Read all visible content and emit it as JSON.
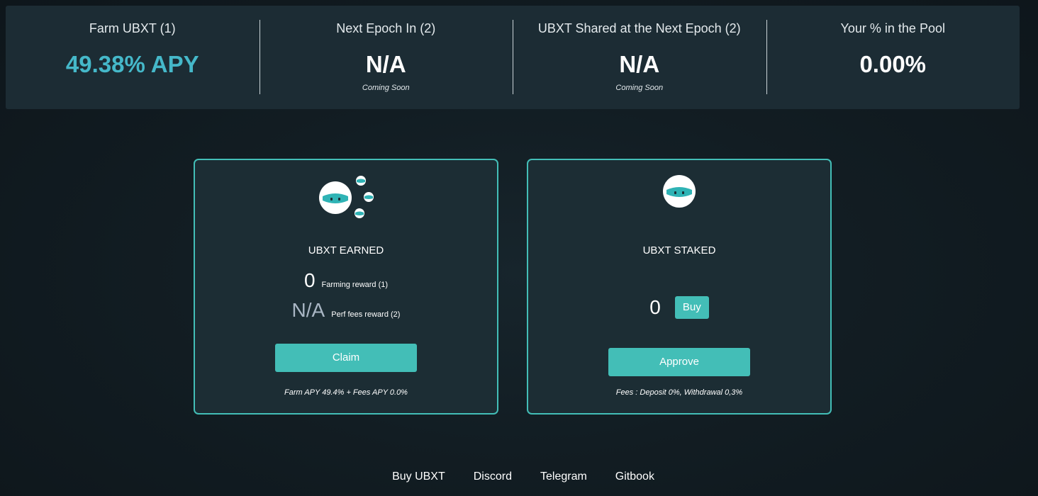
{
  "stats": [
    {
      "label": "Farm UBXT (1)",
      "value": "49.38% APY",
      "sub": ""
    },
    {
      "label": "Next Epoch In (2)",
      "value": "N/A",
      "sub": "Coming Soon"
    },
    {
      "label": "UBXT Shared at the Next Epoch (2)",
      "value": "N/A",
      "sub": "Coming Soon"
    },
    {
      "label": "Your % in the Pool",
      "value": "0.00%",
      "sub": ""
    }
  ],
  "earned": {
    "title": "UBXT EARNED",
    "farming_value": "0",
    "farming_label": "Farming reward (1)",
    "perf_value": "N/A",
    "perf_label": "Perf fees reward (2)",
    "claim_label": "Claim",
    "footnote": "Farm APY 49.4% + Fees APY 0.0%"
  },
  "staked": {
    "title": "UBXT STAKED",
    "value": "0",
    "buy_label": "Buy",
    "approve_label": "Approve",
    "footnote": "Fees : Deposit 0%, Withdrawal 0,3%"
  },
  "footer": {
    "links": [
      "Buy UBXT",
      "Discord",
      "Telegram",
      "Gitbook"
    ]
  },
  "colors": {
    "accent": "#43beb7",
    "apy": "#45b8c9",
    "panel": "#1c2c34",
    "background": "#121d23"
  }
}
